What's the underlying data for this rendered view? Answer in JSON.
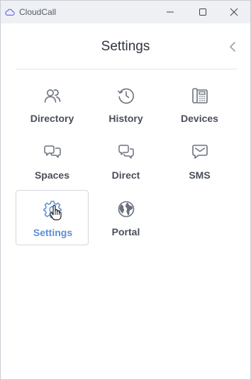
{
  "titlebar": {
    "app_name": "CloudCall",
    "logo_icon": "cloud-icon",
    "controls": [
      "minimize-icon",
      "maximize-icon",
      "close-icon"
    ]
  },
  "header": {
    "title": "Settings",
    "back_icon": "chevron-left-icon"
  },
  "menu": {
    "items": [
      {
        "label": "Directory",
        "icon": "users-icon"
      },
      {
        "label": "History",
        "icon": "clock-icon"
      },
      {
        "label": "Devices",
        "icon": "desk-phone-icon"
      },
      {
        "label": "Spaces",
        "icon": "chat-bubbles-icon"
      },
      {
        "label": "Direct",
        "icon": "direct-message-icon"
      },
      {
        "label": "SMS",
        "icon": "sms-icon"
      },
      {
        "label": "Settings",
        "icon": "gear-icon",
        "selected": true
      },
      {
        "label": "Portal",
        "icon": "globe-icon"
      }
    ]
  },
  "colors": {
    "accent": "#5b8fd6",
    "icon_gray": "#6b717c",
    "titlebar_bg": "#eef0f4"
  }
}
